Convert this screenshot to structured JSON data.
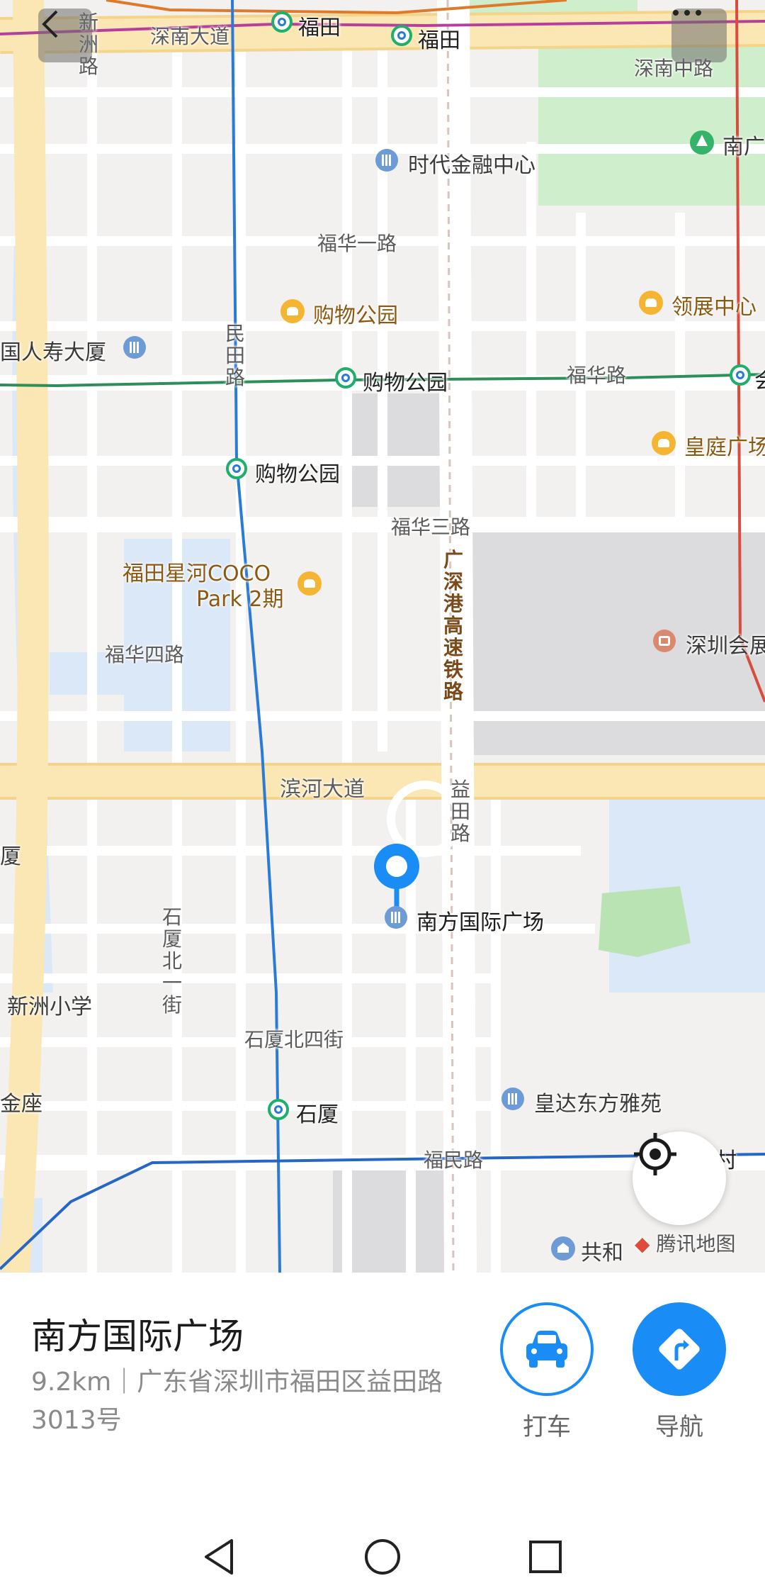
{
  "top_bar": {
    "back_icon": "chevron-left-icon",
    "more_icon": "more-dots-icon"
  },
  "map": {
    "roads": {
      "shennan_ave": "深南大道",
      "shennan_mid": "深南中路",
      "fuhua_1st": "福华一路",
      "fuhua_rd": "福华路",
      "fuhua_3rd": "福华三路",
      "fuhua_4th": "福华四路",
      "binhe_ave": "滨河大道",
      "fumin_rd": "福民路",
      "shixia_n4": "石厦北四街",
      "xinzhou_rd": "新洲路",
      "mintian_rd": "民田路",
      "yitian_rd": "益田路",
      "shixia_n1": "石厦北一街",
      "railway": "广深港高速铁路"
    },
    "metro": {
      "futian_a": "福田",
      "futian_b": "福田",
      "gouwu_a": "购物公园",
      "gouwu_b": "购物公园",
      "hui": "会",
      "shixia": "石厦",
      "cun": "村"
    },
    "pois": {
      "shidai": "时代金融中心",
      "nan_park": "南广",
      "gouwu_mall": "购物公园",
      "lingzhan": "领展中心",
      "renshou": "国人寿大厦",
      "huangting": "皇庭广场",
      "coco": "福田星河COCO",
      "coco_2": "Park 2期",
      "shenzhen_hall": "深圳会展",
      "xia": "厦",
      "xinzhou_school": "新洲小学",
      "jinzuo": "金座",
      "huangda": "皇达东方雅苑",
      "gonghe": "共和",
      "selected": "南方国际广场"
    },
    "watermark": "腾讯地图",
    "locate_icon": "crosshair-icon",
    "pin_icon": "location-pin-icon",
    "colors": {
      "accent": "#1a8cf5",
      "metro_green": "#1fae6b",
      "metro_blue": "#2a7bd8",
      "metro_red": "#d94c3d",
      "highway": "#fbe7b4",
      "park": "#cfeecb",
      "water": "#dbe8f7"
    }
  },
  "place_card": {
    "title": "南方国际广场",
    "address": "9.2km｜广东省深圳市福田区益田路3013号",
    "actions": [
      {
        "label": "打车",
        "icon": "car-icon"
      },
      {
        "label": "导航",
        "icon": "navigate-icon"
      }
    ]
  },
  "system_nav": {
    "back_icon": "nav-back-icon",
    "home_icon": "nav-home-icon",
    "recents_icon": "nav-recents-icon"
  }
}
